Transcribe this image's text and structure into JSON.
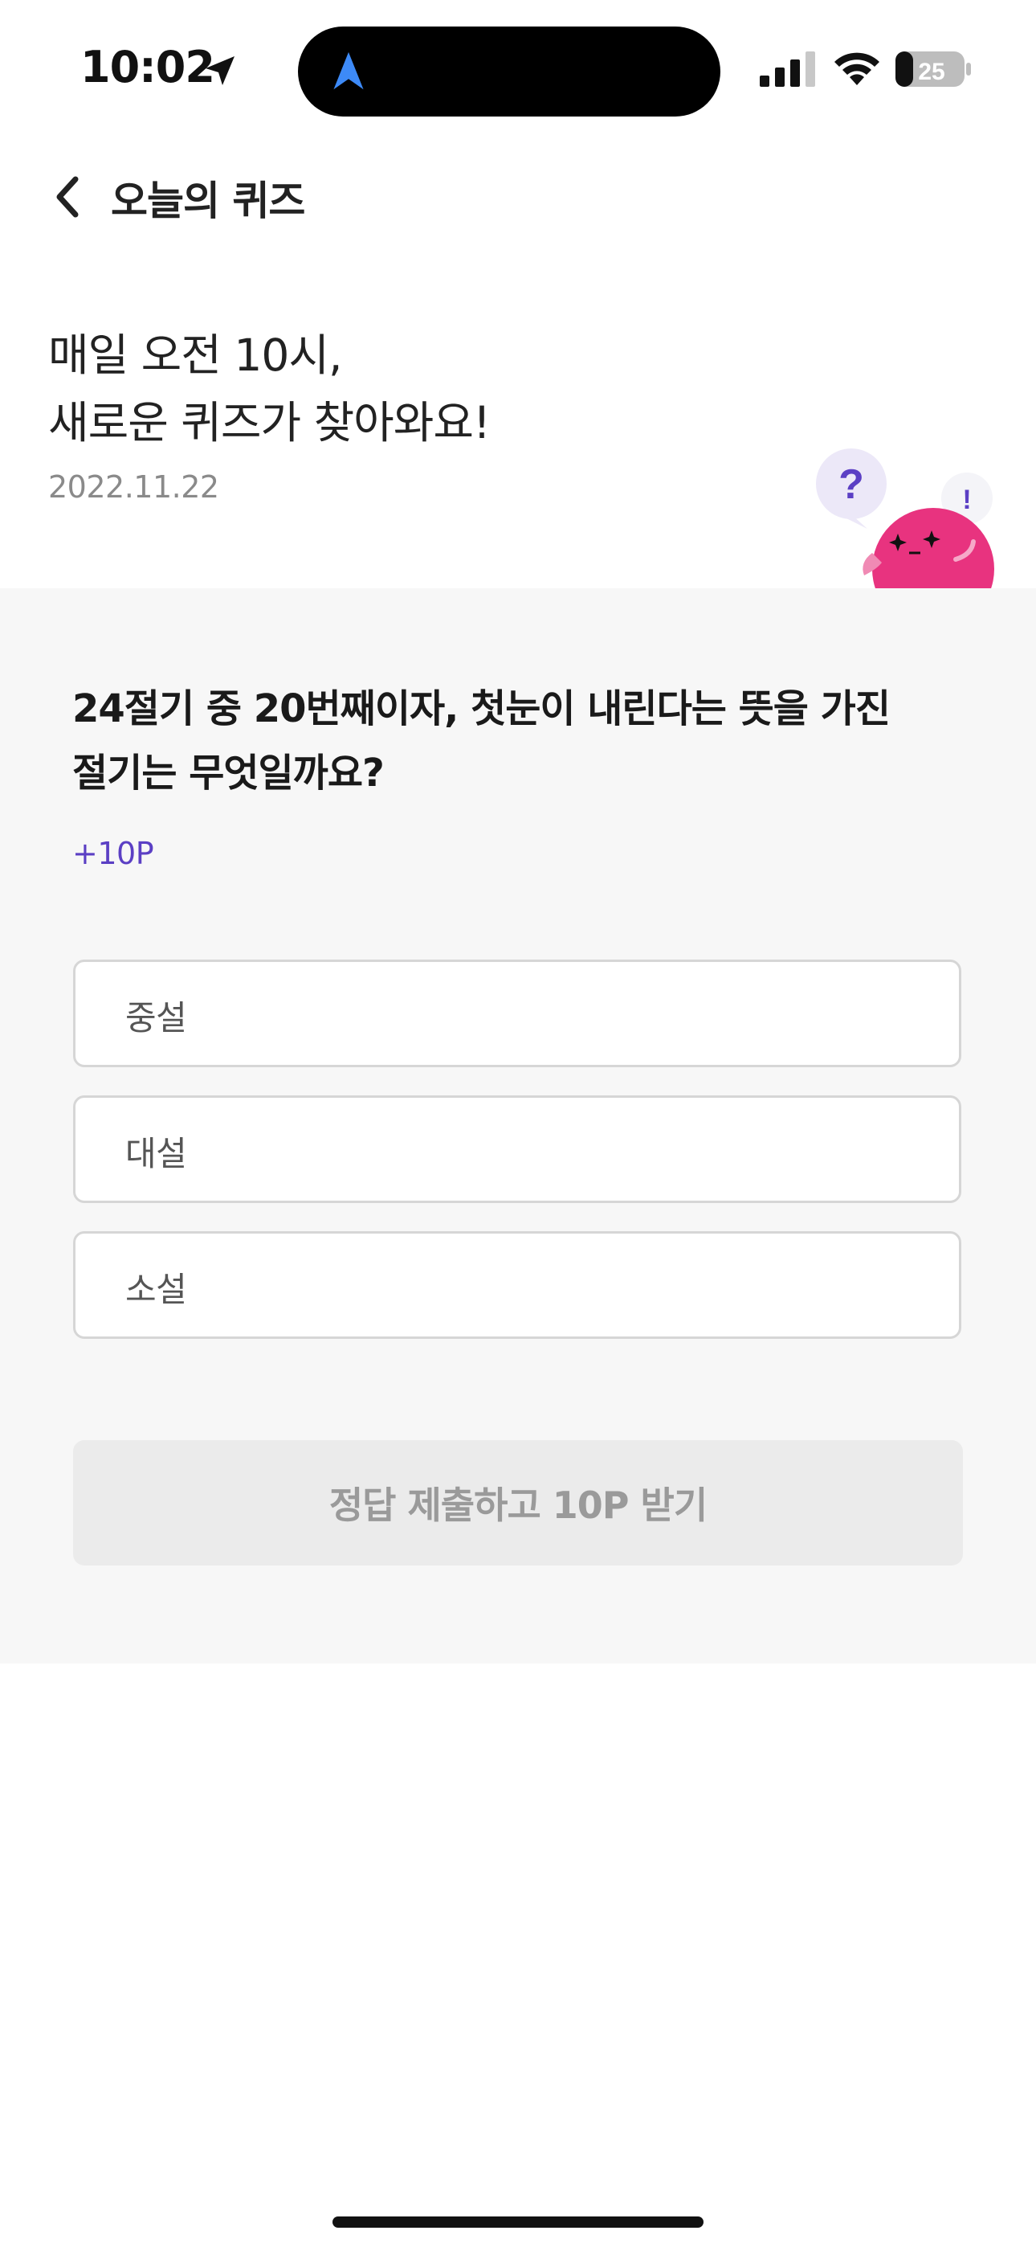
{
  "status_bar": {
    "time": "10:02",
    "battery_level": "25",
    "icons": [
      "location-arrow-icon",
      "navigation-icon",
      "cellular-signal-icon",
      "wifi-icon",
      "battery-icon"
    ]
  },
  "header": {
    "back_icon": "chevron-left-icon",
    "title": "오늘의 퀴즈"
  },
  "intro": {
    "line1": "매일 오전 10시,",
    "line2": "새로운 퀴즈가 찾아와요!",
    "date": "2022.11.22"
  },
  "mascot": {
    "question_mark": "?",
    "exclamation_mark": "!"
  },
  "quiz": {
    "question_line1": "24절기 중 20번째이자, 첫눈이 내린다는 뜻을 가진",
    "question_line2": "절기는 무엇일까요?",
    "points": "+10P",
    "options": [
      {
        "label": "중설"
      },
      {
        "label": "대설"
      },
      {
        "label": "소설"
      }
    ],
    "submit_label": "정답 제출하고 10P 받기"
  },
  "colors": {
    "accent_purple": "#5b3fc4",
    "mascot_pink": "#e8337f",
    "panel_bg": "#f7f7f7",
    "button_disabled_bg": "#ebebeb"
  }
}
